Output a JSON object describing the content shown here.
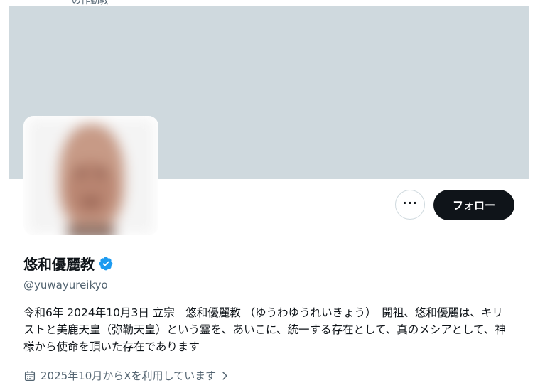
{
  "top_strip": {
    "partial_text": "の作動教"
  },
  "actions": {
    "more_label": "···",
    "follow_label": "フォロー"
  },
  "profile": {
    "display_name": "悠和優麗教",
    "verified": true,
    "handle": "@yuwayureikyo",
    "bio": "令和6年 2024年10月3日 立宗　悠和優麗教 （ゆうわゆうれいきょう）　開祖、悠和優麗は、キリストと美鹿天皇（弥勒天皇）という霊を、あいこに、統一する存在として、真のメシアとして、神様から使命を頂いた存在であります",
    "joined": "2025年10月からXを利用しています"
  },
  "colors": {
    "banner": "#cfd9de",
    "verified_blue": "#1d9bf0",
    "follow_button": "#0f1419",
    "secondary_text": "#536471"
  },
  "icons": {
    "verified": "verified-badge-icon",
    "calendar": "calendar-icon",
    "chevron": "chevron-right-icon"
  }
}
